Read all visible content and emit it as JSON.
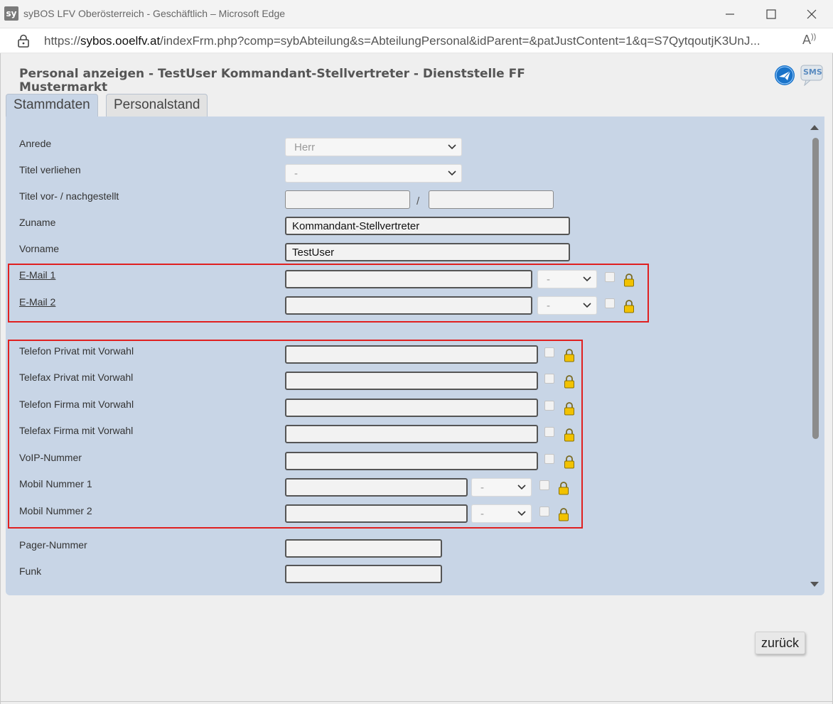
{
  "window": {
    "app_icon_text": "sy",
    "title": "syBOS LFV Oberösterreich - Geschäftlich – Microsoft Edge"
  },
  "address_bar": {
    "url_scheme": "https://",
    "url_host": "sybos.ooelfv.at",
    "url_path": "/indexFrm.php?comp=sybAbteilung&s=AbteilungPersonal&idParent=&patJustContent=1&q=S7QytqoutjK3UnJ..."
  },
  "page": {
    "title": "Personal anzeigen - TestUser Kommandant-Stellvertreter - Dienststelle FF Mustermarkt",
    "sms_label": "SMS"
  },
  "tabs": [
    {
      "label": "Stammdaten",
      "active": true
    },
    {
      "label": "Personalstand",
      "active": false
    }
  ],
  "form": {
    "anrede": {
      "label": "Anrede",
      "value": "Herr"
    },
    "titel_verliehen": {
      "label": "Titel verliehen",
      "value": "-"
    },
    "titel_vor_nach": {
      "label": "Titel vor- / nachgestellt",
      "separator": "/",
      "value_vor": "",
      "value_nach": ""
    },
    "zuname": {
      "label": "Zuname",
      "value": "Kommandant-Stellvertreter"
    },
    "vorname": {
      "label": "Vorname",
      "value": "TestUser"
    },
    "email1": {
      "label": "E-Mail 1",
      "value": "",
      "type_value": "-",
      "checked": false
    },
    "email2": {
      "label": "E-Mail 2",
      "value": "",
      "type_value": "-",
      "checked": false
    },
    "telefon_privat": {
      "label": "Telefon Privat mit Vorwahl",
      "value": "",
      "checked": false
    },
    "telefax_privat": {
      "label": "Telefax Privat mit Vorwahl",
      "value": "",
      "checked": false
    },
    "telefon_firma": {
      "label": "Telefon Firma mit Vorwahl",
      "value": "",
      "checked": false
    },
    "telefax_firma": {
      "label": "Telefax Firma mit Vorwahl",
      "value": "",
      "checked": false
    },
    "voip": {
      "label": "VoIP-Nummer",
      "value": "",
      "checked": false
    },
    "mobil1": {
      "label": "Mobil Nummer 1",
      "value": "",
      "type_value": "-",
      "checked": false
    },
    "mobil2": {
      "label": "Mobil Nummer 2",
      "value": "",
      "type_value": "-",
      "checked": false
    },
    "pager": {
      "label": "Pager-Nummer",
      "value": ""
    },
    "funk": {
      "label": "Funk",
      "value": ""
    }
  },
  "buttons": {
    "back_label": "zurück"
  },
  "colors": {
    "panel_bg": "#c8d5e6",
    "highlight_box": "#e02020",
    "padlock": "#f2c200"
  }
}
